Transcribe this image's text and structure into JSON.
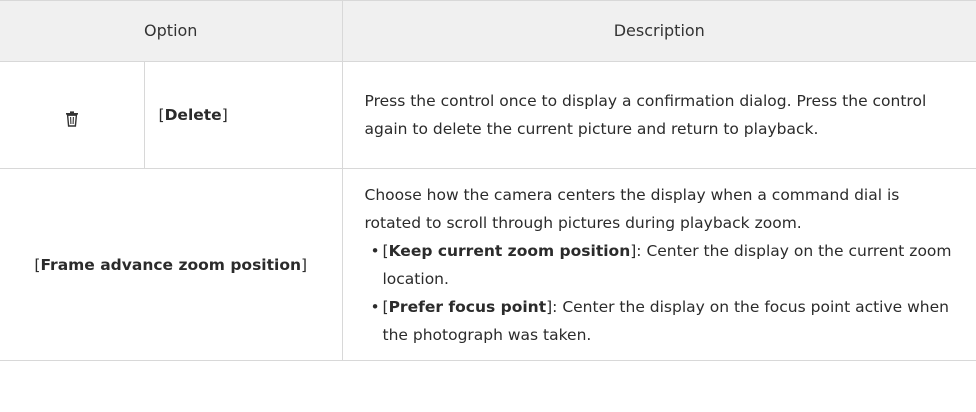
{
  "header": {
    "option": "Option",
    "description": "Description"
  },
  "rows": [
    {
      "icon": "trash-icon",
      "label_open": "[",
      "label_bold": "Delete",
      "label_close": "]",
      "description": "Press the control once to display a confirmation dialog. Press the control again to delete the current picture and return to playback."
    },
    {
      "label_open": "[",
      "label_bold": "Frame advance zoom position",
      "label_close": "]",
      "description": "Choose how the camera centers the display when a command dial is rotated to scroll through pictures during playback zoom.",
      "bullets": [
        {
          "bullet": "•",
          "open": "[",
          "bold": "Keep current zoom position",
          "rest": "]: Center the display on the current zoom location."
        },
        {
          "bullet": "•",
          "open": "[",
          "bold": "Prefer focus point",
          "rest": "]: Center the display on the focus point active when the photograph was taken."
        }
      ]
    }
  ],
  "colors": {
    "header_bg": "#f0f0f0",
    "border": "#d8d8d8",
    "text": "#2b2b2b"
  }
}
